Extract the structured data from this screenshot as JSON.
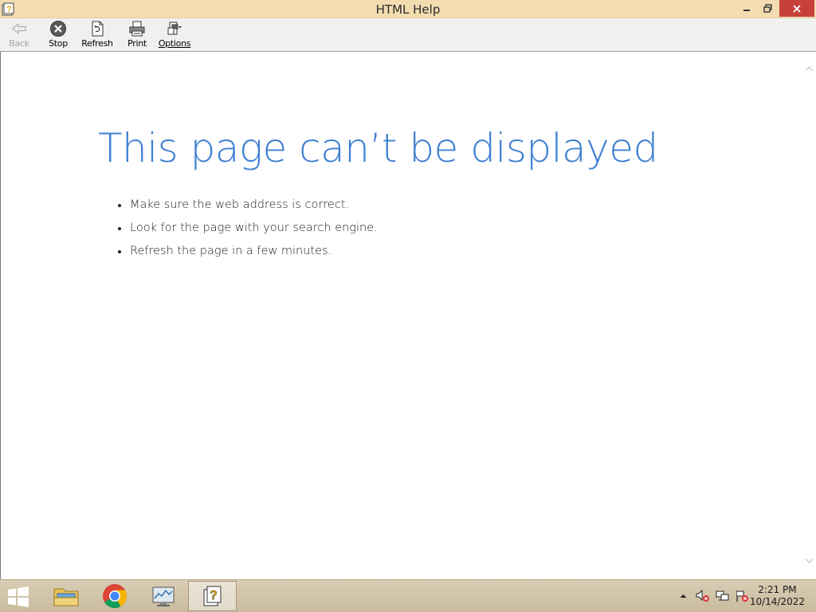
{
  "window": {
    "title": "HTML Help"
  },
  "toolbar": {
    "back_label": "Back",
    "stop_label": "Stop",
    "refresh_label": "Refresh",
    "print_label": "Print",
    "options_label": "Options"
  },
  "content": {
    "heading": "This page can’t be displayed",
    "tips": [
      "Make sure the web address  is correct.",
      "Look for the page with your search engine.",
      "Refresh the page in a few minutes."
    ]
  },
  "taskbar": {
    "apps": [
      "File Explorer",
      "Google Chrome",
      "Performance Monitor",
      "HTML Help"
    ],
    "clock": {
      "time": "2:21 PM",
      "date": "10/14/2022"
    }
  },
  "colors": {
    "titlebar": "#f2dcb0",
    "heading": "#3e7fd1",
    "close_button": "#c7403a"
  }
}
